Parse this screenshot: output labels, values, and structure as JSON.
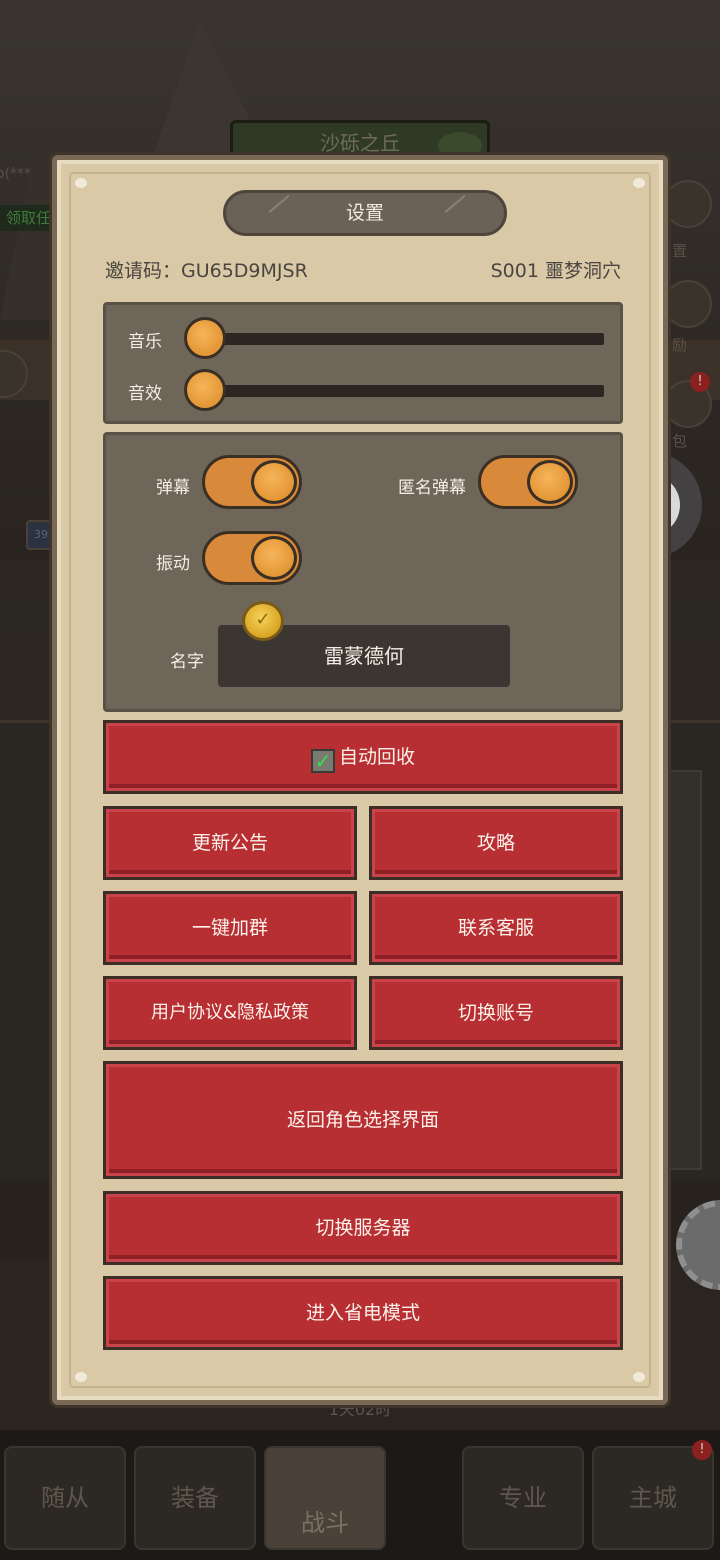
{
  "background": {
    "map_title": "沙砾之丘",
    "left_quest_text": "o(***",
    "left_quest_green": "领取任",
    "side_labels": [
      "置",
      "励",
      "包"
    ],
    "timer_text": "1天02时",
    "bottom_tabs": [
      "随从",
      "装备",
      "战斗",
      "专业",
      "主城"
    ],
    "badge_text": "39"
  },
  "dialog": {
    "title": "设置",
    "invite_label": "邀请码：GU65D9MJSR",
    "server_label": "S001  噩梦洞穴",
    "audio": {
      "music_label": "音乐",
      "sfx_label": "音效",
      "music_level": 0,
      "sfx_level": 0
    },
    "toggles": {
      "danmaku_label": "弹幕",
      "danmaku_on": true,
      "anon_danmaku_label": "匿名弹幕",
      "anon_danmaku_on": true,
      "vibration_label": "振动",
      "vibration_on": true
    },
    "name": {
      "label": "名字",
      "value": "雷蒙德何"
    },
    "buttons": {
      "auto_recycle": "自动回收",
      "auto_recycle_checked": true,
      "update_notice": "更新公告",
      "guide": "攻略",
      "join_group": "一键加群",
      "contact_support": "联系客服",
      "user_agreement": "用户协议&隐私政策",
      "switch_account": "切换账号",
      "back_to_character": "返回角色选择界面",
      "switch_server": "切换服务器",
      "power_saving": "进入省电模式"
    }
  },
  "colors": {
    "dialog_bg": "#d9c9a7",
    "panel_bg": "#6f665a",
    "button_red": "#b82f33",
    "knob_orange": "#e39635"
  }
}
